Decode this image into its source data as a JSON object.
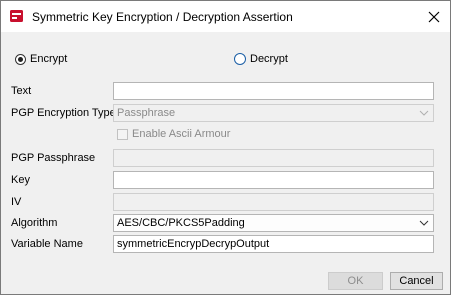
{
  "window": {
    "title": "Symmetric Key Encryption / Decryption Assertion"
  },
  "mode": {
    "encrypt_label": "Encrypt",
    "decrypt_label": "Decrypt",
    "selected": "Encrypt"
  },
  "form": {
    "text_label": "Text",
    "text_value": "",
    "pgp_type_label": "PGP Encryption Type",
    "pgp_type_value": "Passphrase",
    "ascii_armour_label": "Enable Ascii Armour",
    "ascii_armour_checked": false,
    "pgp_passphrase_label": "PGP Passphrase",
    "pgp_passphrase_value": "",
    "key_label": "Key",
    "key_value": "",
    "iv_label": "IV",
    "iv_value": "",
    "algorithm_label": "Algorithm",
    "algorithm_value": "AES/CBC/PKCS5Padding",
    "variable_name_label": "Variable Name",
    "variable_name_value": "symmetricEncrypDecrypOutput"
  },
  "buttons": {
    "ok_label": "OK",
    "cancel_label": "Cancel"
  }
}
